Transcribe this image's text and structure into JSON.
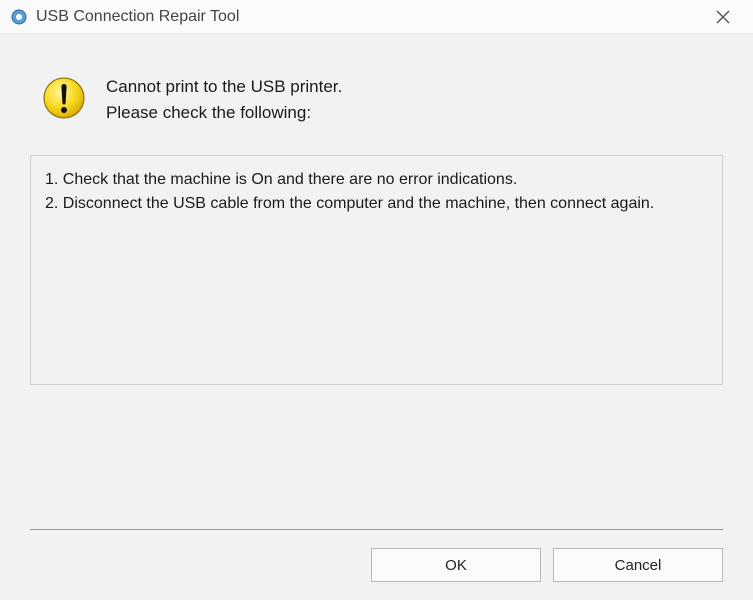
{
  "titlebar": {
    "title": "USB Connection Repair Tool"
  },
  "message": {
    "line1": "Cannot print to the USB printer.",
    "line2": "Please check the following:"
  },
  "instructions": {
    "item1": "1. Check that the machine is On and there are no error indications.",
    "item2": "2. Disconnect the USB cable from the computer and the machine, then connect again."
  },
  "buttons": {
    "ok": "OK",
    "cancel": "Cancel"
  }
}
